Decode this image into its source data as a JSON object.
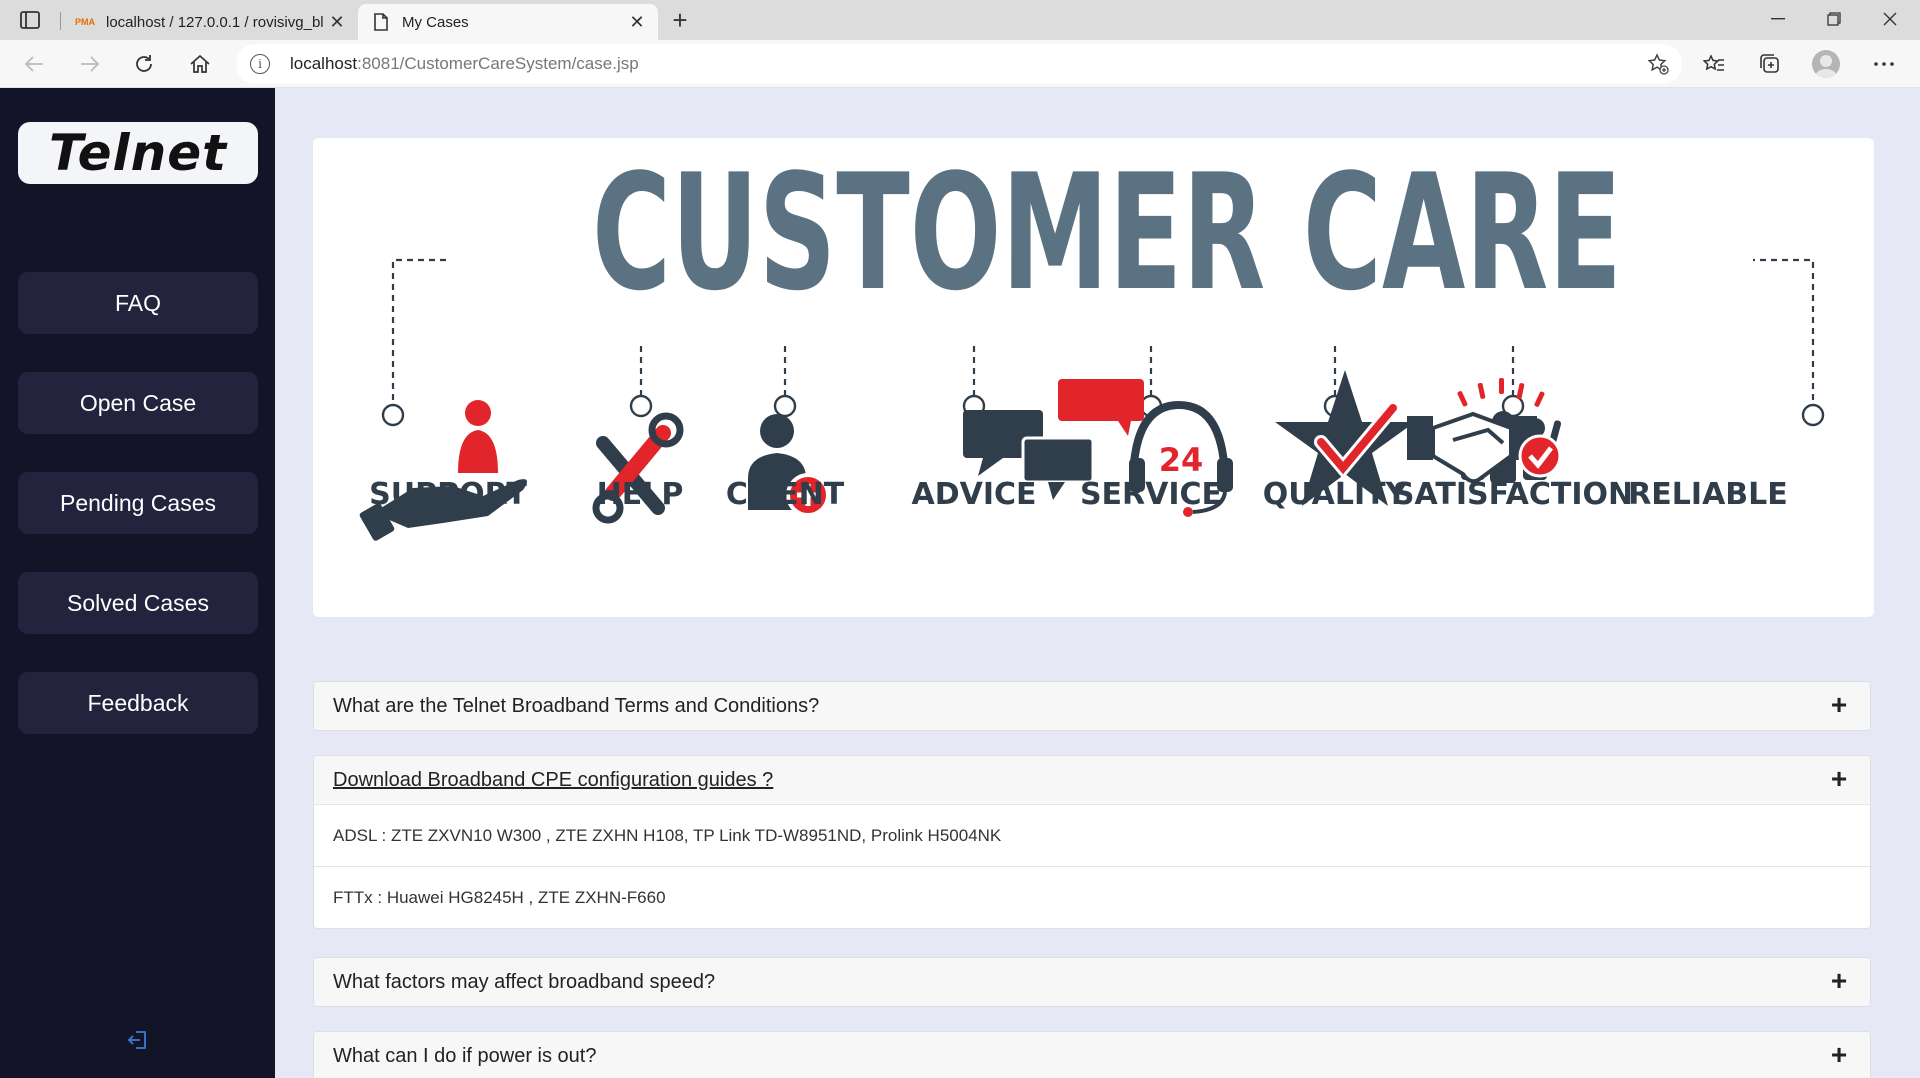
{
  "browser": {
    "tabs": [
      {
        "title": "localhost / 127.0.0.1 / rovisivg_bl",
        "favicon": "pma",
        "active": false
      },
      {
        "title": "My Cases",
        "active": true
      }
    ],
    "url_host": "localhost",
    "url_rest": ":8081/CustomerCareSystem/case.jsp"
  },
  "sidebar": {
    "brand": "Telnet",
    "items": [
      {
        "label": "FAQ"
      },
      {
        "label": "Open Case"
      },
      {
        "label": "Pending Cases"
      },
      {
        "label": "Solved Cases"
      },
      {
        "label": "Feedback"
      }
    ]
  },
  "banner": {
    "heading": "CUSTOMER CARE",
    "labels": [
      "SUPPORT",
      "HELP",
      "CLIENT",
      "ADVICE",
      "SERVICE",
      "QUALITY",
      "SATISFACTION",
      "RELIABLE"
    ],
    "service_hours": "24",
    "colors": {
      "slate": "#5a7282",
      "dark": "#2f3e4a",
      "red": "#e1252b"
    }
  },
  "faq": [
    {
      "question": "What are the Telnet Broadband Terms and Conditions?",
      "expanded": false
    },
    {
      "question": "Download Broadband CPE configuration guides ?",
      "expanded": true,
      "answers": [
        "ADSL : ZTE ZXVN10 W300 , ZTE ZXHN H108, TP Link TD-W8951ND, Prolink H5004NK",
        "FTTx : Huawei HG8245H , ZTE ZXHN-F660"
      ]
    },
    {
      "question": "What factors may affect broadband speed?",
      "expanded": false
    },
    {
      "question": "What can I do if power is out?",
      "expanded": false
    }
  ],
  "colors": {
    "sidebar_bg": "#141428",
    "sidebar_item_bg": "#23233d",
    "main_bg": "#e6e9f5"
  }
}
